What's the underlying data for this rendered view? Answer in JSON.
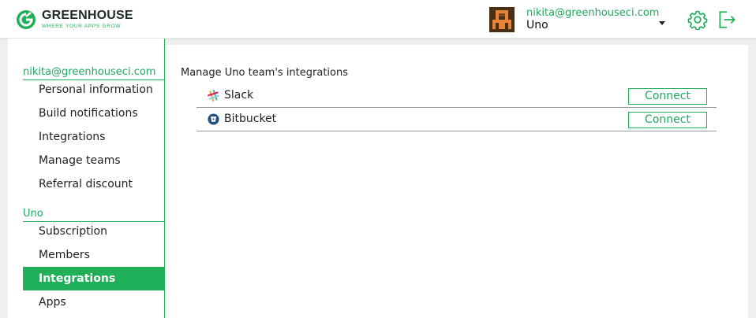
{
  "brand": {
    "name": "GREENHOUSE",
    "tagline": "WHERE YOUR APPS GROW",
    "accent_color": "#21b05a"
  },
  "header": {
    "user_email": "nikita@greenhouseci.com",
    "team_name": "Uno",
    "icons": [
      "avatar",
      "chevron-down-icon",
      "gear-icon",
      "logout-icon"
    ]
  },
  "sidebar": {
    "account_section": "nikita@greenhouseci.com",
    "account_items": [
      {
        "label": "Personal information"
      },
      {
        "label": "Build notifications"
      },
      {
        "label": "Integrations"
      },
      {
        "label": "Manage teams"
      },
      {
        "label": "Referral discount"
      }
    ],
    "team_section": "Uno",
    "team_items": [
      {
        "label": "Subscription"
      },
      {
        "label": "Members"
      },
      {
        "label": "Integrations",
        "active": true
      },
      {
        "label": "Apps"
      }
    ]
  },
  "main": {
    "title": "Manage Uno team's integrations",
    "integrations": [
      {
        "name": "Slack",
        "icon": "slack-icon",
        "action": "Connect"
      },
      {
        "name": "Bitbucket",
        "icon": "bitbucket-icon",
        "action": "Connect"
      }
    ]
  }
}
